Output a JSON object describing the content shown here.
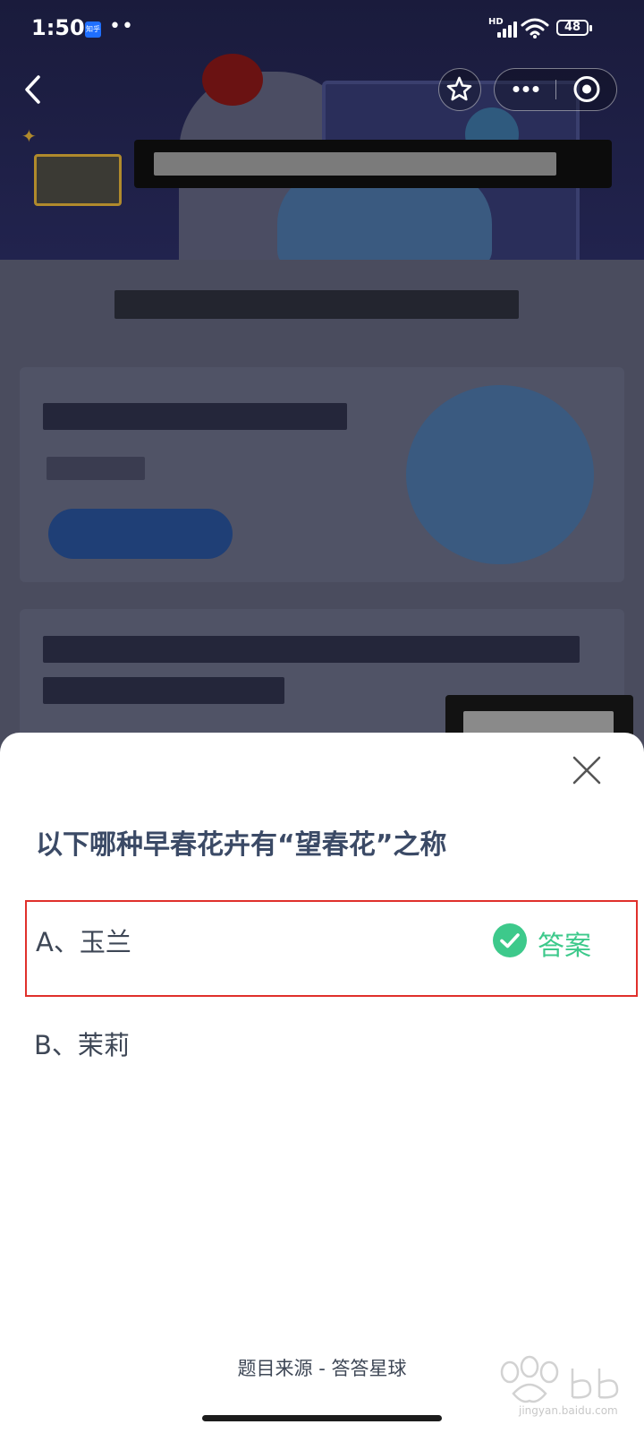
{
  "status_bar": {
    "time": "1:50",
    "app_badge": "知乎",
    "notification_dots": "••",
    "network_label": "HD",
    "battery": "48"
  },
  "quiz": {
    "question": "以下哪种早春花卉有“望春花”之称",
    "options": [
      {
        "label": "A、玉兰",
        "is_answer": true
      },
      {
        "label": "B、茉莉",
        "is_answer": false
      }
    ],
    "answer_tag": "答案",
    "source": "题目来源 - 答答星球"
  },
  "watermark": {
    "text": "jingyan.baidu.com"
  },
  "colors": {
    "accent_green": "#3dc98b",
    "highlight_red": "#e0302b",
    "question_text": "#3b4a66"
  }
}
